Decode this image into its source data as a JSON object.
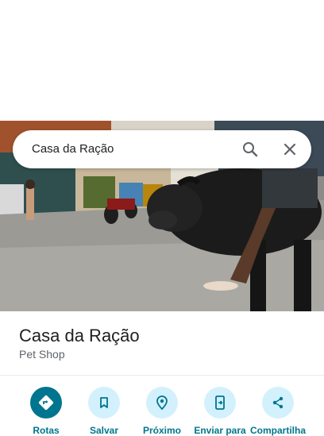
{
  "search": {
    "query": "Casa da Ração"
  },
  "place": {
    "name": "Casa da Ração",
    "category": "Pet Shop"
  },
  "actions": [
    {
      "label": "Rotas",
      "icon": "directions-icon"
    },
    {
      "label": "Salvar",
      "icon": "bookmark-icon"
    },
    {
      "label": "Próximo",
      "icon": "nearby-icon"
    },
    {
      "label": "Enviar para",
      "icon": "send-to-phone-icon"
    },
    {
      "label": "Compartilha",
      "icon": "share-icon"
    }
  ],
  "colors": {
    "accent": "#00758f",
    "accent_light": "#d2f1fc",
    "text_primary": "#202124",
    "text_secondary": "#5f6368"
  }
}
